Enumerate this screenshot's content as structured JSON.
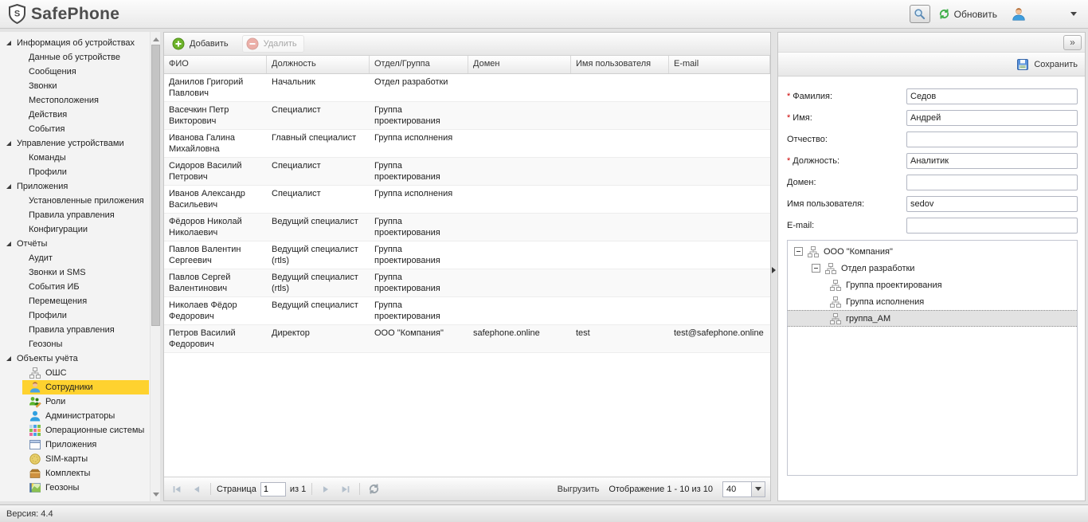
{
  "app": {
    "brand": "SafePhone",
    "version": "Версия: 4.4"
  },
  "header": {
    "refresh_label": "Обновить"
  },
  "sidebar": {
    "groups": [
      {
        "label": "Информация об устройствах",
        "items": [
          {
            "label": "Данные об устройстве"
          },
          {
            "label": "Сообщения"
          },
          {
            "label": "Звонки"
          },
          {
            "label": "Местоположения"
          },
          {
            "label": "Действия"
          },
          {
            "label": "События"
          }
        ]
      },
      {
        "label": "Управление устройствами",
        "items": [
          {
            "label": "Команды"
          },
          {
            "label": "Профили"
          }
        ]
      },
      {
        "label": "Приложения",
        "items": [
          {
            "label": "Установленные приложения"
          },
          {
            "label": "Правила управления"
          },
          {
            "label": "Конфигурации"
          }
        ]
      },
      {
        "label": "Отчёты",
        "items": [
          {
            "label": "Аудит"
          },
          {
            "label": "Звонки и SMS"
          },
          {
            "label": "События ИБ"
          },
          {
            "label": "Перемещения"
          },
          {
            "label": "Профили"
          },
          {
            "label": "Правила управления"
          },
          {
            "label": "Геозоны"
          }
        ]
      },
      {
        "label": "Объекты учёта",
        "items": [
          {
            "label": "ОШС",
            "icon": "orgchart"
          },
          {
            "label": "Сотрудники",
            "icon": "employee",
            "selected": true
          },
          {
            "label": "Роли",
            "icon": "roles"
          },
          {
            "label": "Администраторы",
            "icon": "admin"
          },
          {
            "label": "Операционные системы",
            "icon": "os"
          },
          {
            "label": "Приложения",
            "icon": "window"
          },
          {
            "label": "SIM-карты",
            "icon": "sim"
          },
          {
            "label": "Комплекты",
            "icon": "box"
          },
          {
            "label": "Геозоны",
            "icon": "map"
          }
        ]
      }
    ]
  },
  "grid": {
    "toolbar": {
      "add_label": "Добавить",
      "delete_label": "Удалить"
    },
    "columns": [
      "ФИО",
      "Должность",
      "Отдел/Группа",
      "Домен",
      "Имя пользователя",
      "E-mail"
    ],
    "rows": [
      [
        "Данилов Григорий Павлович",
        "Начальник",
        "Отдел разработки",
        "",
        "",
        ""
      ],
      [
        "Васечкин Петр Викторович",
        "Специалист",
        "Группа проектирования",
        "",
        "",
        ""
      ],
      [
        "Иванова Галина Михайловна",
        "Главный специалист",
        "Группа исполнения",
        "",
        "",
        ""
      ],
      [
        "Сидоров Василий Петрович",
        "Специалист",
        "Группа проектирования",
        "",
        "",
        ""
      ],
      [
        "Иванов Александр Васильевич",
        "Специалист",
        "Группа исполнения",
        "",
        "",
        ""
      ],
      [
        "Фёдоров Николай Николаевич",
        "Ведущий специалист",
        "Группа проектирования",
        "",
        "",
        ""
      ],
      [
        "Павлов Валентин Сергеевич",
        "Ведущий специалист (rtls)",
        "Группа проектирования",
        "",
        "",
        ""
      ],
      [
        "Павлов Сергей Валентинович",
        "Ведущий специалист (rtls)",
        "Группа проектирования",
        "",
        "",
        ""
      ],
      [
        "Николаев Фёдор Федорович",
        "Ведущий специалист",
        "Группа проектирования",
        "",
        "",
        ""
      ],
      [
        "Петров Василий Федорович",
        "Директор",
        "ООО \"Компания\"",
        "safephone.online",
        "test",
        "test@safephone.online"
      ]
    ],
    "paging": {
      "page_label": "Страница",
      "page_value": "1",
      "of_label": "из 1",
      "export_label": "Выгрузить",
      "display_label": "Отображение 1 - 10 из 10",
      "page_size": "40"
    }
  },
  "detail": {
    "collapse_label": "»",
    "save_label": "Сохранить",
    "fields": [
      {
        "label": "Фамилия:",
        "required": true,
        "value": "Седов"
      },
      {
        "label": "Имя:",
        "required": true,
        "value": "Андрей"
      },
      {
        "label": "Отчество:",
        "required": false,
        "value": ""
      },
      {
        "label": "Должность:",
        "required": true,
        "value": "Аналитик"
      },
      {
        "label": "Домен:",
        "required": false,
        "value": ""
      },
      {
        "label": "Имя пользователя:",
        "required": false,
        "value": "sedov"
      },
      {
        "label": "E-mail:",
        "required": false,
        "value": ""
      }
    ],
    "tree": [
      {
        "label": "ООО \"Компания\"",
        "level": 0,
        "expandable": true
      },
      {
        "label": "Отдел разработки",
        "level": 1,
        "expandable": true
      },
      {
        "label": "Группа проектирования",
        "level": 2
      },
      {
        "label": "Группа исполнения",
        "level": 2
      },
      {
        "label": "группа_АМ",
        "level": 2,
        "selected": true
      }
    ]
  },
  "colors": {
    "selection_yellow": "#fed22f",
    "add_green": "#5ba823",
    "delete_red": "#dd6a5c",
    "save_blue": "#4a86c8"
  }
}
